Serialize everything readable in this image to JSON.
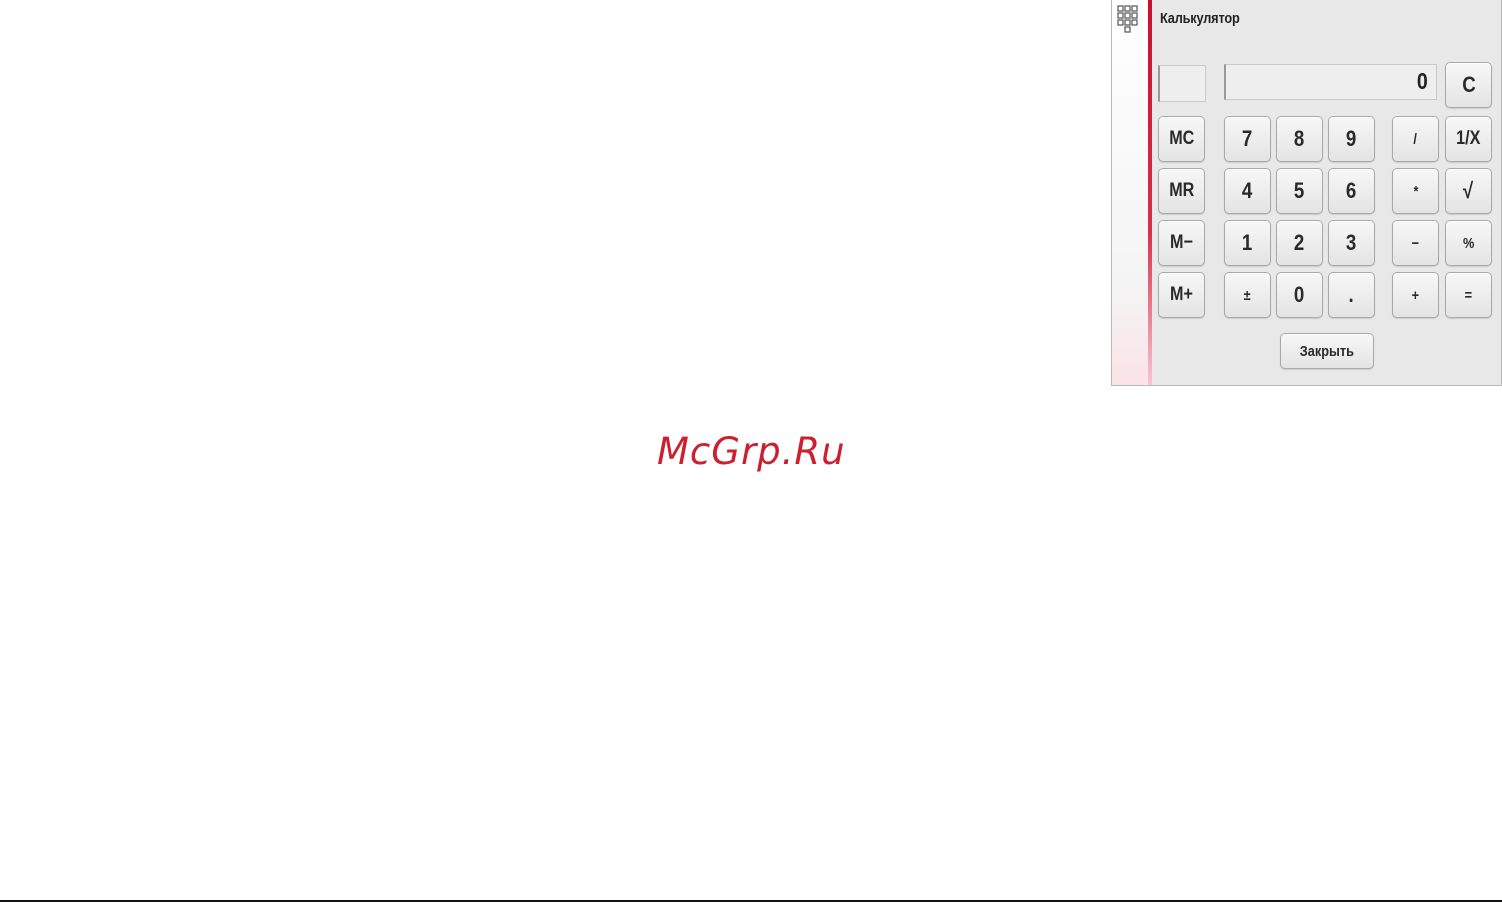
{
  "window": {
    "title": "Калькулятор",
    "icon": "calculator-grid-icon"
  },
  "display": {
    "memory_value": "",
    "value": "0"
  },
  "buttons": {
    "clear": "C",
    "memory": [
      "MC",
      "MR",
      "M−",
      "M+"
    ],
    "digits_row1": [
      "7",
      "8",
      "9"
    ],
    "digits_row2": [
      "4",
      "5",
      "6"
    ],
    "digits_row3": [
      "1",
      "2",
      "3"
    ],
    "digits_row4": [
      "±",
      "0",
      "."
    ],
    "ops_col1": [
      "/",
      "*",
      "−",
      "+"
    ],
    "ops_col2": [
      "1/X",
      "√",
      "%",
      "="
    ],
    "close": "Закрыть"
  },
  "watermark": "McGrp.Ru",
  "colors": {
    "accent": "#c8102e",
    "watermark": "#cc1f2f"
  }
}
